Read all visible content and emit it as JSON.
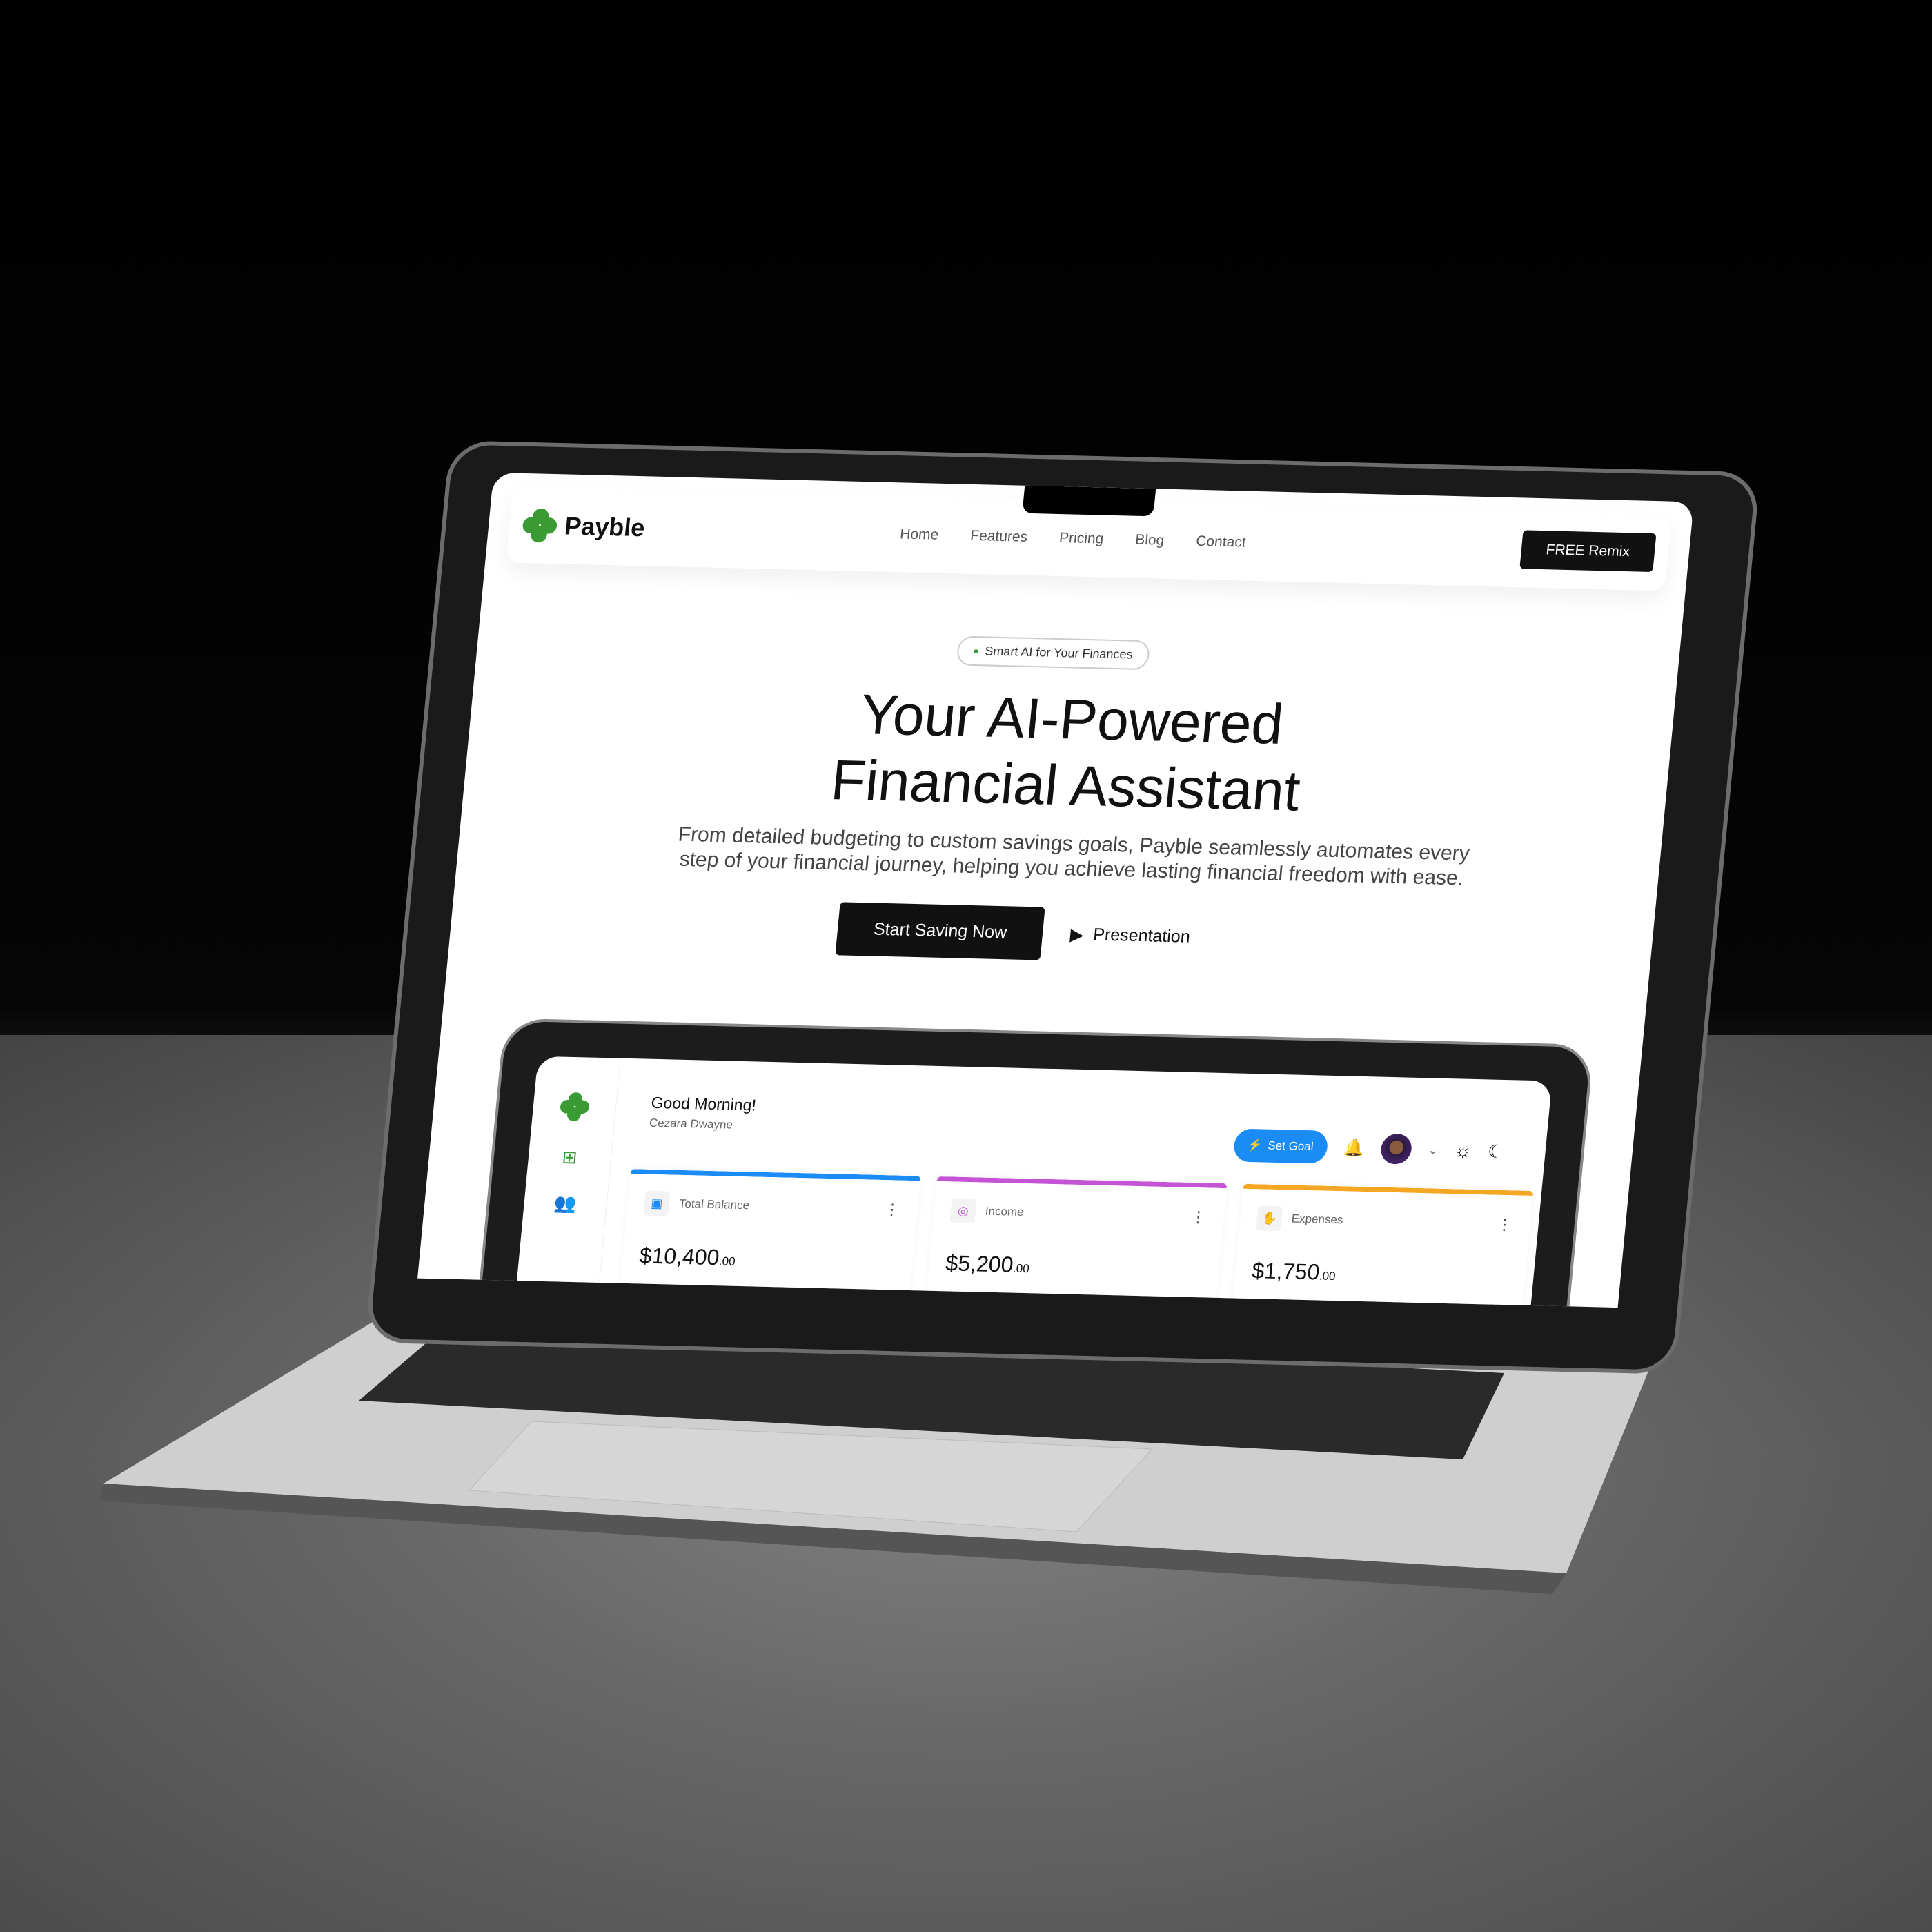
{
  "brand": {
    "name": "Payble",
    "accent": "#3a9b35"
  },
  "nav": {
    "links": [
      "Home",
      "Features",
      "Pricing",
      "Blog",
      "Contact"
    ],
    "cta": "FREE Remix"
  },
  "hero": {
    "badge": "Smart AI for Your Finances",
    "title_line1": "Your AI-Powered",
    "title_line2": "Financial Assistant",
    "description": "From detailed budgeting to custom savings goals, Payble seamlessly automates every step of your financial journey, helping you achieve lasting financial freedom with ease.",
    "primary_button": "Start Saving Now",
    "secondary_button": "Presentation"
  },
  "dashboard": {
    "greeting": "Good Morning!",
    "user": "Cezara Dwayne",
    "set_goal": "Set Goal",
    "cards": [
      {
        "label": "Total Balance",
        "amount": "$10,400",
        "cents": ".00",
        "color": "#1b8cf5",
        "icon": "wallet-icon"
      },
      {
        "label": "Income",
        "amount": "$5,200",
        "cents": ".00",
        "color": "#c553d6",
        "icon": "coins-icon"
      },
      {
        "label": "Expenses",
        "amount": "$1,750",
        "cents": ".00",
        "color": "#f5a623",
        "icon": "hand-coins-icon"
      }
    ]
  }
}
